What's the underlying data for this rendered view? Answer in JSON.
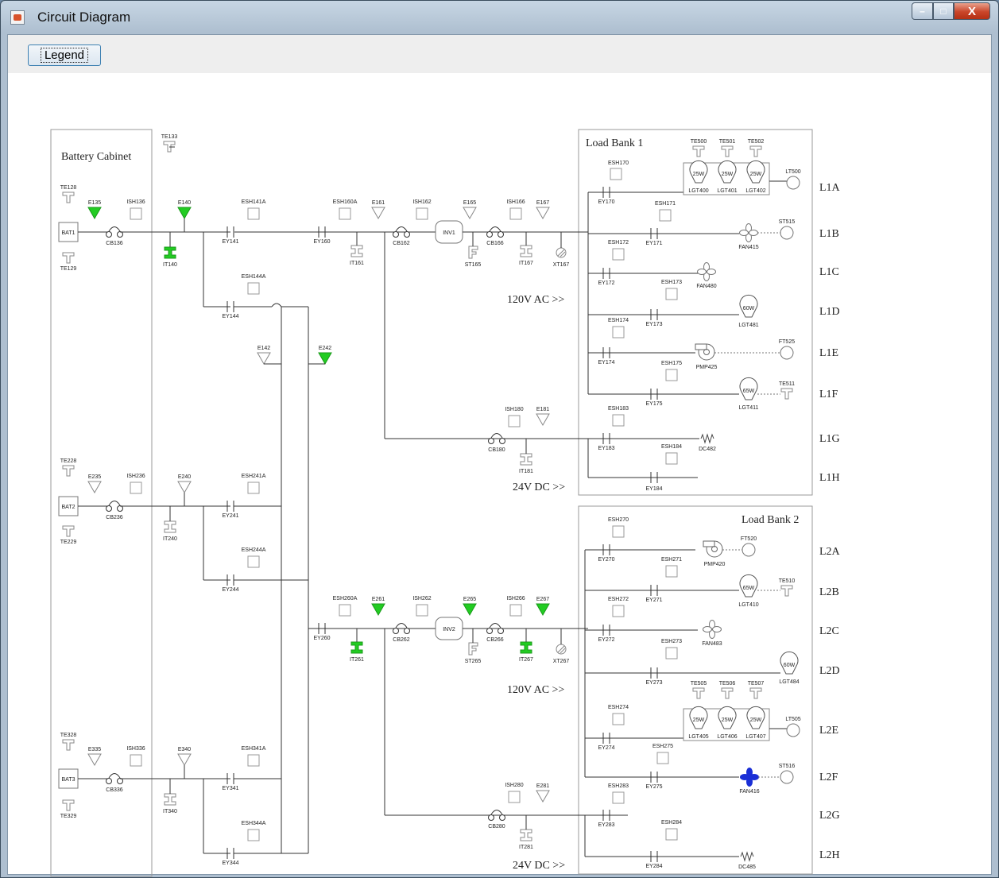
{
  "window": {
    "title": "Circuit Diagram",
    "minimize": "–",
    "maximize": "□",
    "close": "X"
  },
  "toolbar": {
    "legend_label": "Legend"
  },
  "diagram": {
    "battery_cabinet": "Battery Cabinet",
    "load_bank_1": "Load Bank 1",
    "load_bank_2": "Load Bank 2",
    "bus_ac_1": "120V AC >>",
    "bus_dc_1": "24V DC >>",
    "bus_ac_2": "120V AC >>",
    "bus_dc_2": "24V DC >>",
    "circuits_1": [
      "L1A",
      "L1B",
      "L1C",
      "L1D",
      "L1E",
      "L1F",
      "L1G",
      "L1H"
    ],
    "circuits_2": [
      "L2A",
      "L2B",
      "L2C",
      "L2D",
      "L2E",
      "L2F",
      "L2G",
      "L2H"
    ],
    "batteries": [
      "BAT1",
      "BAT2",
      "BAT3"
    ],
    "inverters": [
      "INV1",
      "INV2"
    ],
    "lamp_ratings": [
      "25W",
      "25W",
      "25W",
      "60W",
      "65W",
      "65W",
      "60W",
      "25W",
      "25W",
      "25W"
    ],
    "labels": {
      "te133": "TE133",
      "te128": "TE128",
      "te129": "TE129",
      "e135": "E135",
      "ish136": "ISH136",
      "cb136": "CB136",
      "e140": "E140",
      "it140": "IT140",
      "esh141a": "ESH141A",
      "ey141": "EY141",
      "esh144a": "ESH144A",
      "ey144": "EY144",
      "esh160a": "ESH160A",
      "ey160": "EY160",
      "it161": "IT161",
      "e161": "E161",
      "ish162": "ISH162",
      "cb162": "CB162",
      "e165": "E165",
      "st165": "ST165",
      "ish166": "ISH166",
      "cb166": "CB166",
      "e167": "E167",
      "it167": "IT167",
      "xt167": "XT167",
      "e142": "E142",
      "e242": "E242",
      "ish180": "ISH180",
      "e181": "E181",
      "cb180": "CB180",
      "it181": "IT181",
      "esh170": "ESH170",
      "ey170": "EY170",
      "te500": "TE500",
      "te501": "TE501",
      "te502": "TE502",
      "lgt400": "LGT400",
      "lgt401": "LGT401",
      "lgt402": "LGT402",
      "lt500": "LT500",
      "esh171": "ESH171",
      "ey171": "EY171",
      "fan415": "FAN415",
      "st515": "ST515",
      "esh172": "ESH172",
      "ey172": "EY172",
      "fan480": "FAN480",
      "esh173": "ESH173",
      "ey173": "EY173",
      "lgt481": "LGT481",
      "esh174": "ESH174",
      "ey174": "EY174",
      "pmp425": "PMP425",
      "ft525": "FT525",
      "esh175": "ESH175",
      "ey175": "EY175",
      "lgt411": "LGT411",
      "te511": "TE511",
      "esh183": "ESH183",
      "ey183": "EY183",
      "esh184": "ESH184",
      "dc482": "DC482",
      "ey184": "EY184",
      "te228": "TE228",
      "te229": "TE229",
      "e235": "E235",
      "ish236": "ISH236",
      "cb236": "CB236",
      "e240": "E240",
      "it240": "IT240",
      "esh241a": "ESH241A",
      "ey241": "EY241",
      "esh244a": "ESH244A",
      "ey244": "EY244",
      "esh260a": "ESH260A",
      "ey260": "EY260",
      "e261": "E261",
      "it261": "IT261",
      "ish262": "ISH262",
      "cb262": "CB262",
      "e265": "E265",
      "st265": "ST265",
      "ish266": "ISH266",
      "cb266": "CB266",
      "e267": "E267",
      "it267": "IT267",
      "xt267": "XT267",
      "ish280": "ISH280",
      "e281": "E281",
      "cb280": "CB280",
      "it281": "IT281",
      "esh270": "ESH270",
      "ey270": "EY270",
      "pmp420": "PMP420",
      "ft520": "FT520",
      "esh271": "ESH271",
      "ey271": "EY271",
      "lgt410": "LGT410",
      "te510": "TE510",
      "esh272": "ESH272",
      "ey272": "EY272",
      "fan483": "FAN483",
      "esh273": "ESH273",
      "ey273": "EY273",
      "lgt484": "LGT484",
      "esh274": "ESH274",
      "ey274": "EY274",
      "te505": "TE505",
      "te506": "TE506",
      "te507": "TE507",
      "lgt405": "LGT405",
      "lgt406": "LGT406",
      "lgt407": "LGT407",
      "lt505": "LT505",
      "esh275": "ESH275",
      "ey275": "EY275",
      "fan416": "FAN416",
      "st516": "ST516",
      "esh283": "ESH283",
      "ey283": "EY283",
      "esh284": "ESH284",
      "ey284": "EY284",
      "dc485": "DC485",
      "te328": "TE328",
      "te329": "TE329",
      "e335": "E335",
      "ish336": "ISH336",
      "cb336": "CB336",
      "e340": "E340",
      "it340": "IT340",
      "esh341a": "ESH341A",
      "ey341": "EY341",
      "esh344a": "ESH344A",
      "ey344": "EY344"
    }
  },
  "colors": {
    "active": "#22cc22",
    "fan_active": "#1a2fd6",
    "line": "#333333",
    "box": "#999999"
  }
}
